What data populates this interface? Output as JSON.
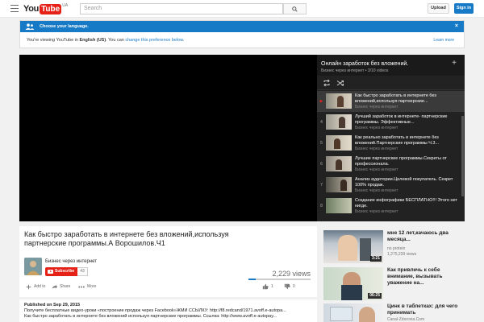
{
  "header": {
    "logo_you": "You",
    "logo_tube": "Tube",
    "logo_region": "UA",
    "search_placeholder": "Search",
    "upload_label": "Upload",
    "signin_label": "Sign in"
  },
  "banner": {
    "title": "Choose your language.",
    "text_prefix": "You're viewing YouTube in ",
    "text_lang": "English (US)",
    "text_middle": ". You can ",
    "text_link": "change this preference below",
    "text_suffix": ".",
    "learn_more": "Learn more",
    "close": "×"
  },
  "playlist": {
    "title": "Онлайн заработок без вложений.",
    "subtitle": "Бизнес через интернет • 3/10 videos",
    "add": "+",
    "items": [
      {
        "index": "▶",
        "title": "Как быстро заработать в интернете без вложений,используя партнерские...",
        "channel": "Бизнес через интернет",
        "active": true
      },
      {
        "index": "4",
        "title": "Лучший заработок в интернете- партнерские программы. Эффективные...",
        "channel": "Бизнес через интернет",
        "active": false
      },
      {
        "index": "5",
        "title": "Как реально заработать в интернете без вложений.Партнерские программы Ч.3...",
        "channel": "Бизнес через интернет",
        "active": false
      },
      {
        "index": "6",
        "title": "Лучшие партнерские программы.Секреты от профессионала.",
        "channel": "Бизнес через интернет",
        "active": false
      },
      {
        "index": "7",
        "title": "Анализ аудитории.Целевой покупатель. Секрет 100% продаж.",
        "channel": "Бизнес через интернет",
        "active": false
      },
      {
        "index": "8",
        "title": "Создание инфографики БЕСПЛАТНО!!! Этого нет нигде.",
        "channel": "Бизнес через интернет",
        "active": false
      }
    ]
  },
  "video": {
    "title": "Как быстро заработать в интернете без вложений,используя партнерские программы.А Ворошилов.Ч1",
    "channel": "Бизнес через интернет",
    "subscribe_label": "Subscribe",
    "subscriber_count": "43",
    "views": "2,229 views",
    "like_fraction": 0.12,
    "actions": {
      "add_to": "Add to",
      "share": "Share",
      "more": "More",
      "likes": "1",
      "dislikes": "0"
    }
  },
  "description": {
    "published": "Published on Sep 29, 2015",
    "line1": "Получите бесплатные видео-уроки «построение продаж через Facebook»ЖМИ ССЫЛКУ: http://f8.redcand/1971.avoff.e-autopa...",
    "line2": "Как быстро заработать в интернете без вложений используя партнерские программы. Ссылка: http://www.avoff.e-autopay..."
  },
  "suggestions": [
    {
      "title": "мне 12 лет,качаюсь два месяца...",
      "channel": "no protein",
      "views": "1,275,239 views",
      "duration": "3:21"
    },
    {
      "title": "Как привлечь к себе внимание, вызывать уважение на...",
      "channel": "",
      "views": "",
      "duration": "06:25"
    },
    {
      "title": "Цинк в таблетках: для чего принимать",
      "channel": "Canal-Zdorovia.Com",
      "views": "",
      "duration": ""
    }
  ]
}
